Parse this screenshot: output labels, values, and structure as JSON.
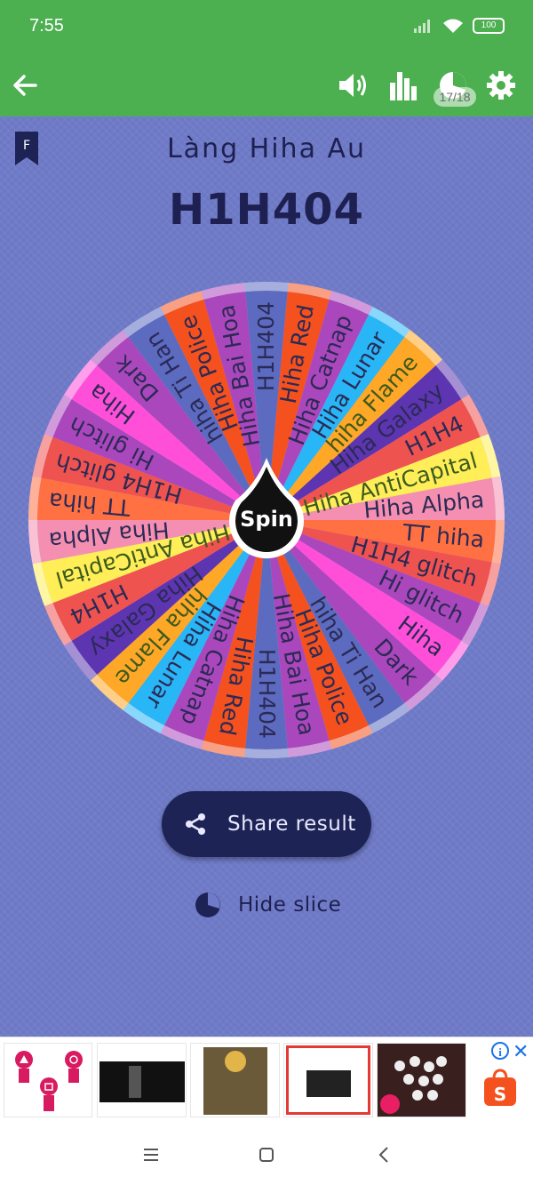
{
  "status": {
    "time": "7:55",
    "battery": "100"
  },
  "toolbar": {
    "slice_counter": "17/18"
  },
  "header": {
    "subtitle": "Làng Hiha Au",
    "title": "H1H404",
    "bookmark_letter": "F"
  },
  "wheel": {
    "center_label": "Spin",
    "slices": [
      {
        "label": "H1H404",
        "color": "#5c6bc0"
      },
      {
        "label": "Hiha Red",
        "color": "#f4511e"
      },
      {
        "label": "Hiha Catnap",
        "color": "#ab47bc"
      },
      {
        "label": "Hiha Lunar",
        "color": "#29b6f6"
      },
      {
        "label": "hiha Flame",
        "color": "#ffa726"
      },
      {
        "label": "Hiha Galaxy",
        "color": "#5e35b1"
      },
      {
        "label": "H1H4",
        "color": "#ef5350"
      },
      {
        "label": "Hiha AntiCapital",
        "color": "#ffee58"
      },
      {
        "label": "Hiha Alpha",
        "color": "#f48fb1"
      },
      {
        "label": "TT hiha",
        "color": "#ff7043"
      },
      {
        "label": "H1H4 glitch",
        "color": "#ef5350"
      },
      {
        "label": "Hi glitch",
        "color": "#ab47bc"
      },
      {
        "label": "Hiha",
        "color": "#ff4fd8"
      },
      {
        "label": "Dark",
        "color": "#ab47bc"
      },
      {
        "label": "hiha Ti Han",
        "color": "#5c6bc0"
      },
      {
        "label": "Hiha Police",
        "color": "#f4511e"
      },
      {
        "label": "Hiha Bai Hoa",
        "color": "#ab47bc"
      }
    ]
  },
  "actions": {
    "share_label": "Share result",
    "hide_label": "Hide slice"
  },
  "ad": {
    "info": "i",
    "close": "✕"
  }
}
